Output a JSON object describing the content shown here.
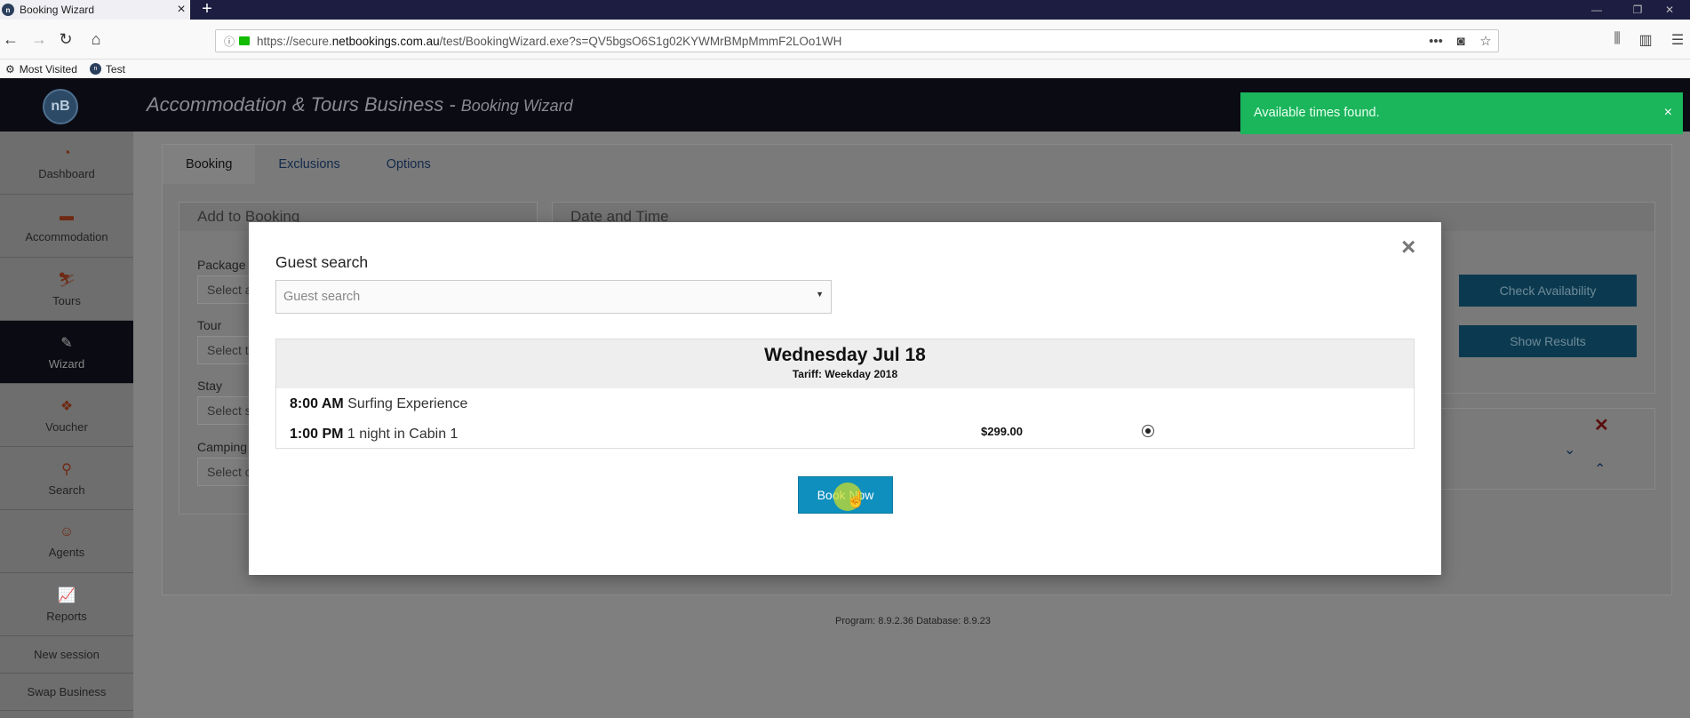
{
  "browser": {
    "tab_title": "Booking Wizard",
    "url_prefix": "https://secure.",
    "url_domain": "netbookings.com.au",
    "url_suffix": "/test/BookingWizard.exe?s=QV5bgsO6S1g02KYWMrBMpMmmF2LOo1WH",
    "bookmarks": [
      "Most Visited",
      "Test"
    ]
  },
  "app": {
    "logo_text": "nB",
    "title": "Accommodation & Tours Business - ",
    "subtitle": "Booking Wizard"
  },
  "sidebar": {
    "items": [
      {
        "label": "Dashboard",
        "icon": "dashboard-icon"
      },
      {
        "label": "Accommodation",
        "icon": "bed-icon"
      },
      {
        "label": "Tours",
        "icon": "tours-icon"
      },
      {
        "label": "Wizard",
        "icon": "wand-icon",
        "active": true
      },
      {
        "label": "Voucher",
        "icon": "gift-icon"
      },
      {
        "label": "Search",
        "icon": "search-icon"
      },
      {
        "label": "Agents",
        "icon": "agent-icon"
      },
      {
        "label": "Reports",
        "icon": "chart-icon"
      }
    ],
    "links": [
      "New session",
      "Swap Business"
    ]
  },
  "main": {
    "tabs": [
      "Booking",
      "Exclusions",
      "Options"
    ],
    "add_to_booking": {
      "title": "Add to Booking",
      "fields": [
        {
          "label": "Package",
          "placeholder": "Select a"
        },
        {
          "label": "Tour",
          "placeholder": "Select t"
        },
        {
          "label": "Stay",
          "placeholder": "Select s"
        },
        {
          "label": "Camping",
          "placeholder": "Select c"
        }
      ]
    },
    "date_time": {
      "title": "Date and Time",
      "check_label": "Check Availability",
      "show_label": "Show Results"
    },
    "version": "Program: 8.9.2.36 Database: 8.9.23"
  },
  "toast": {
    "message": "Available times found.",
    "close": "×"
  },
  "modal": {
    "title": "Guest search",
    "close": "×",
    "guest_placeholder": "Guest search",
    "day": "Wednesday Jul 18",
    "tariff": "Tariff: Weekday 2018",
    "rows": [
      {
        "time": "8:00 AM",
        "desc": "Surfing Experience"
      },
      {
        "time": "1:00 PM",
        "desc": "1 night in Cabin 1"
      }
    ],
    "price": "$299.00",
    "book_label": "Book Now"
  }
}
